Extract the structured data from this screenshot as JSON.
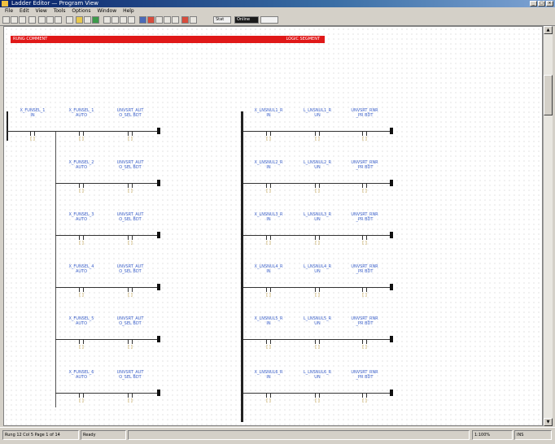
{
  "window": {
    "title": "Ladder Editor — Program View"
  },
  "menu": [
    "File",
    "Edit",
    "View",
    "Tools",
    "Options",
    "Window",
    "Help"
  ],
  "toolbar": {
    "field1": "Stat",
    "field2": "Online"
  },
  "banner": {
    "left": "RUNG COMMENT",
    "right": "LOGIC SEGMENT"
  },
  "tag_glyph": "[ ]",
  "statusbar": {
    "left": "Rung 12 Col 5 Page 1 of 14",
    "mid": "Ready",
    "right1": "1:100%",
    "right2": "INS"
  },
  "left_rungs": [
    {
      "tags": [
        "X_FUNSEL_1\nIN",
        "X_FUNSEL_1\nAUTO",
        "UNVSRT_AUT\nO_SEL BDT"
      ]
    },
    {
      "tags": [
        "X_FUNSEL_2\nAUTO",
        "UNVSRT_AUT\nO_SEL BDT"
      ]
    },
    {
      "tags": [
        "X_FUNSEL_3\nAUTO",
        "UNVSRT_AUT\nO_SEL BDT"
      ]
    },
    {
      "tags": [
        "X_FUNSEL_4\nAUTO",
        "UNVSRT_AUT\nO_SEL BDT"
      ]
    },
    {
      "tags": [
        "X_FUNSEL_5\nAUTO",
        "UNVSRT_AUT\nO_SEL BDT"
      ]
    },
    {
      "tags": [
        "X_FUNSEL_6\nAUTO",
        "UNVSRT_AUT\nO_SEL BDT"
      ]
    }
  ],
  "right_rungs": [
    {
      "tags": [
        "X_LNSNUL1_R\nIN",
        "L_LNSNUL1_R\nUN",
        "UNVSRT_RNR\n_PR BDT"
      ]
    },
    {
      "tags": [
        "X_LNSNUL2_R\nIN",
        "L_LNSNUL2_R\nUN",
        "UNVSRT_RNR\n_PR BDT"
      ]
    },
    {
      "tags": [
        "X_LNSNUL3_R\nIN",
        "L_LNSNUL3_R\nUN",
        "UNVSRT_RNR\n_PR BDT"
      ]
    },
    {
      "tags": [
        "X_LNSNUL4_R\nIN",
        "L_LNSNUL4_R\nUN",
        "UNVSRT_RNR\n_PR BDT"
      ]
    },
    {
      "tags": [
        "X_LNSNUL5_R\nIN",
        "L_LNSNUL5_R\nUN",
        "UNVSRT_RNR\n_PR BDT"
      ]
    },
    {
      "tags": [
        "X_LNSNUL6_R\nIN",
        "L_LNSNUL6_R\nUN",
        "UNVSRT_RNR\n_PR BDT"
      ]
    }
  ],
  "colors": {
    "banner": "#e01818",
    "tag_text": "#3a5fc8",
    "rail": "#222222"
  }
}
